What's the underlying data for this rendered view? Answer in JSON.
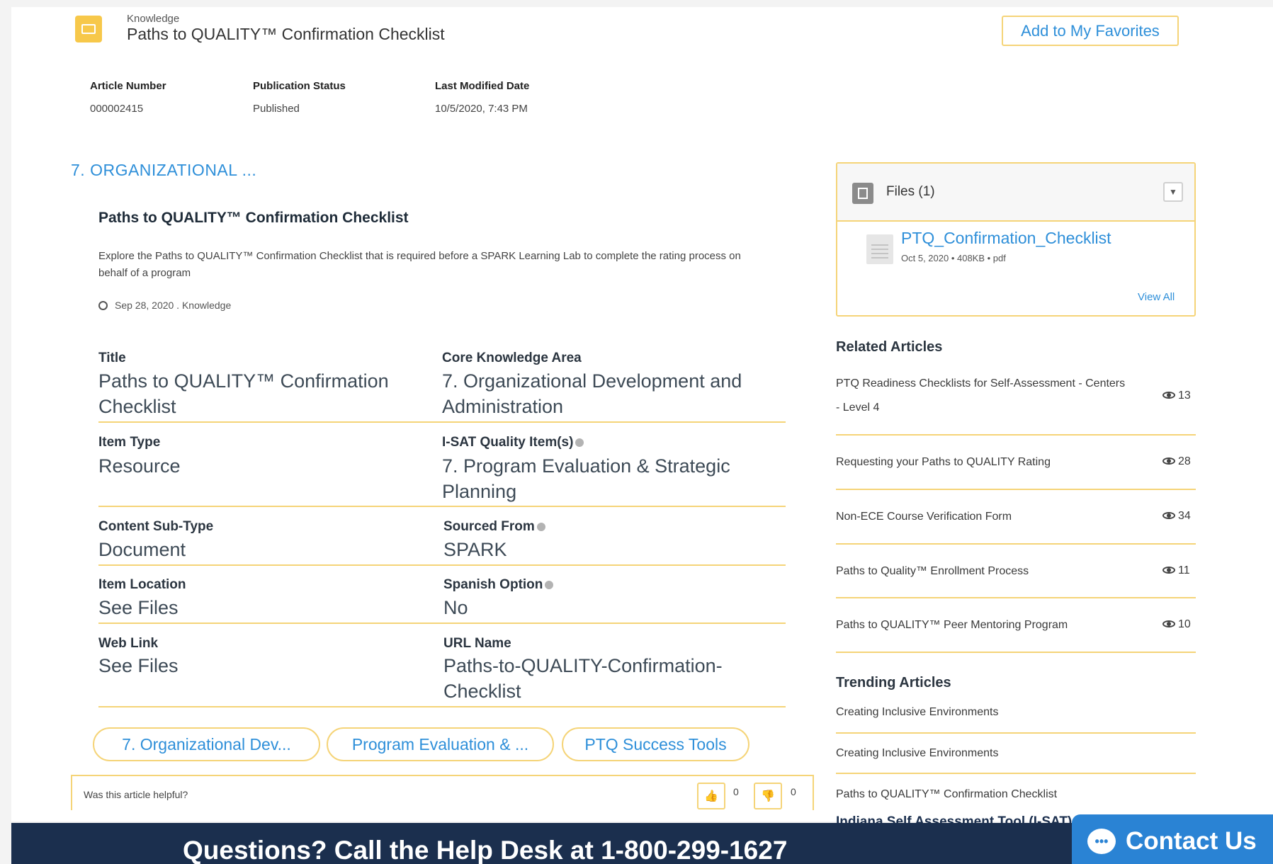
{
  "header": {
    "object_label": "Knowledge",
    "title": "Paths to QUALITY™ Confirmation Checklist",
    "favorites_button": "Add to My Favorites"
  },
  "meta": [
    {
      "label": "Article Number",
      "value": "000002415"
    },
    {
      "label": "Publication Status",
      "value": "Published"
    },
    {
      "label": "Last Modified Date",
      "value": "10/5/2020, 7:43 PM"
    }
  ],
  "section": {
    "title": "7. ORGANIZATIONAL ..."
  },
  "article": {
    "title": "Paths to QUALITY™ Confirmation Checklist",
    "description": "Explore the Paths to QUALITY™ Confirmation Checklist that is required before a SPARK Learning Lab to complete the rating process on behalf of a program",
    "date_line": "Sep 28, 2020 . Knowledge"
  },
  "fields": {
    "title": {
      "label": "Title",
      "value": "Paths to QUALITY™ Confirmation Checklist"
    },
    "core_area": {
      "label": "Core Knowledge Area",
      "value": "7. Organizational Development and Administration"
    },
    "item_type": {
      "label": "Item Type",
      "value": "Resource"
    },
    "isat": {
      "label": "I-SAT Quality Item(s)",
      "value": "7. Program Evaluation & Strategic Planning"
    },
    "content_subtype": {
      "label": "Content Sub-Type",
      "value": "Document"
    },
    "sourced_from": {
      "label": "Sourced From",
      "value": "SPARK"
    },
    "item_location": {
      "label": "Item Location",
      "value": "See Files"
    },
    "spanish_option": {
      "label": "Spanish Option",
      "value": "No"
    },
    "web_link": {
      "label": "Web Link",
      "value": "See Files"
    },
    "url_name": {
      "label": "URL Name",
      "value": "Paths-to-QUALITY-Confirmation-Checklist"
    }
  },
  "tags": [
    "7. Organizational Dev...",
    "Program Evaluation & ...",
    "PTQ Success Tools"
  ],
  "feedback": {
    "question": "Was this article helpful?",
    "upvotes": "0",
    "downvotes": "0"
  },
  "files": {
    "title": "Files (1)",
    "file_name": "PTQ_Confirmation_Checklist",
    "file_meta": "Oct 5, 2020 • 408KB • pdf",
    "view_all": "View All"
  },
  "related": {
    "heading": "Related Articles",
    "items": [
      {
        "title_line1": "PTQ Readiness Checklists for Self-Assessment - Centers",
        "title_line2": "- Level 4",
        "views": "13"
      },
      {
        "title": "Requesting your Paths to QUALITY Rating",
        "views": "28"
      },
      {
        "title": "Non-ECE Course Verification Form",
        "views": "34"
      },
      {
        "title": "Paths to Quality™ Enrollment Process",
        "views": "11"
      },
      {
        "title": "Paths to QUALITY™ Peer Mentoring Program",
        "views": "10"
      }
    ]
  },
  "trending": {
    "heading": "Trending Articles",
    "items": [
      "Creating Inclusive Environments",
      "Creating Inclusive Environments",
      "Paths to QUALITY™ Confirmation Checklist",
      "Indiana Self Assessment Tool (I-SAT)"
    ]
  },
  "footer": {
    "help_text": "Questions? Call the Help Desk at 1-800-299-1627",
    "contact_label": "Contact Us"
  }
}
